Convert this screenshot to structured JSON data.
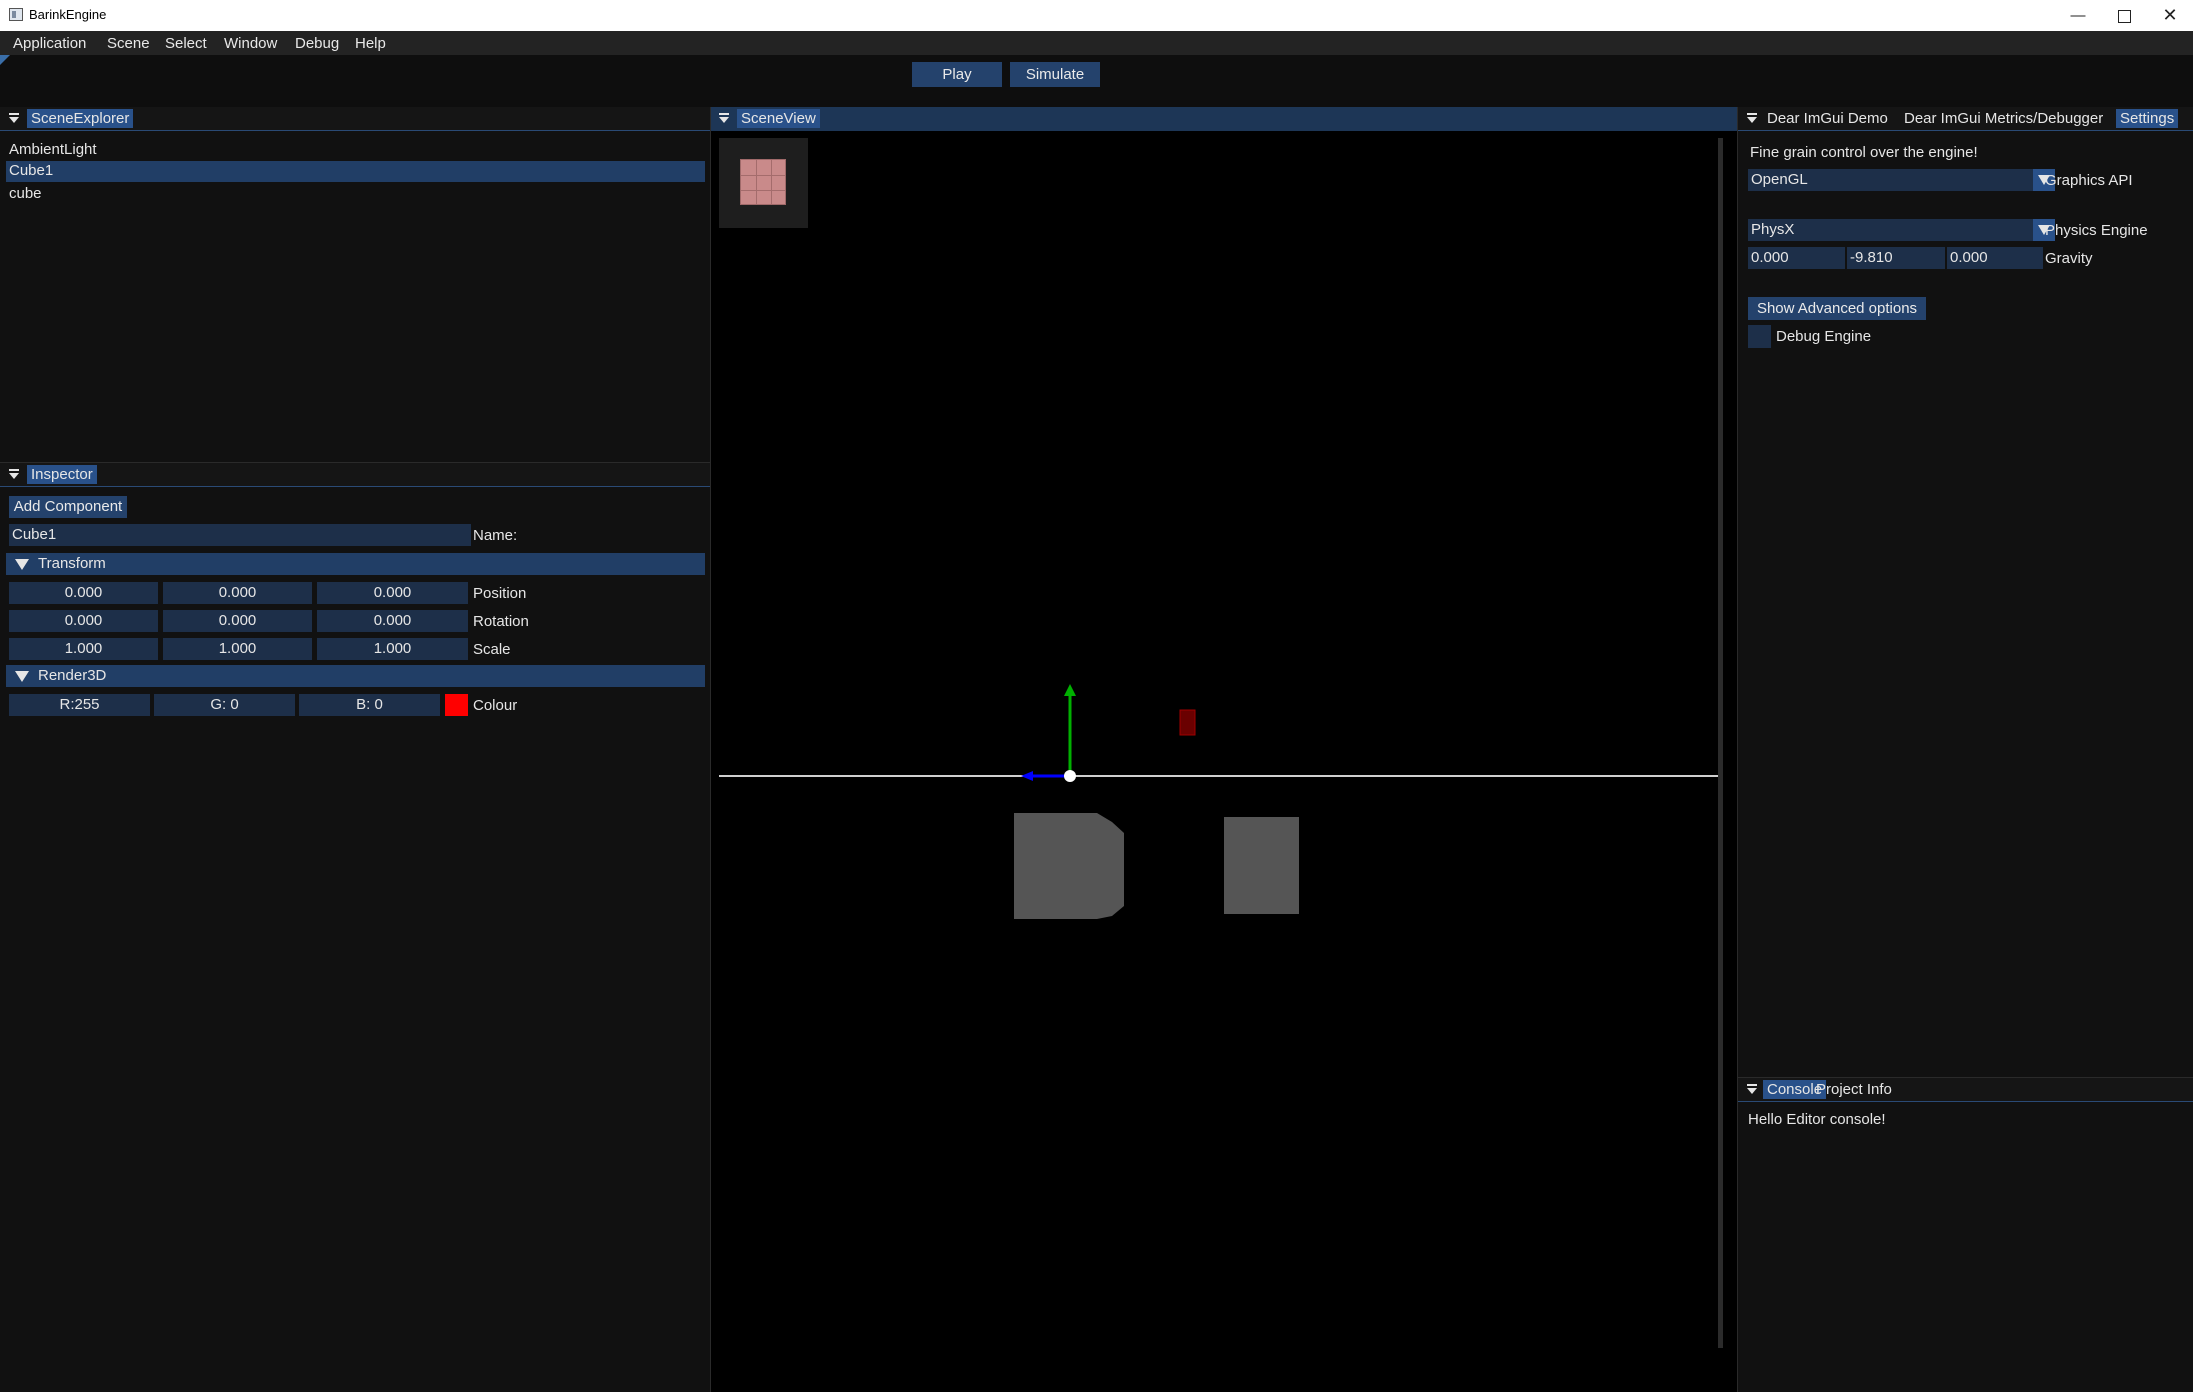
{
  "window": {
    "title": "BarinkEngine"
  },
  "menu": [
    "Application",
    "Scene",
    "Select",
    "Window",
    "Debug",
    "Help"
  ],
  "toolbar": {
    "play": "Play",
    "simulate": "Simulate"
  },
  "scene_explorer": {
    "tab": "SceneExplorer",
    "items": [
      "AmbientLight",
      "Cube1",
      "cube"
    ],
    "selected": "Cube1"
  },
  "inspector": {
    "tab": "Inspector",
    "add_component": "Add Component",
    "name_value": "Cube1",
    "name_label": "Name:",
    "transform": {
      "header": "Transform",
      "position": [
        "0.000",
        "0.000",
        "0.000"
      ],
      "position_label": "Position",
      "rotation": [
        "0.000",
        "0.000",
        "0.000"
      ],
      "rotation_label": "Rotation",
      "scale": [
        "1.000",
        "1.000",
        "1.000"
      ],
      "scale_label": "Scale"
    },
    "render3d": {
      "header": "Render3D",
      "r": "R:255",
      "g": "G:  0",
      "b": "B:  0",
      "colour_label": "Colour",
      "colour": "#ff0000"
    }
  },
  "scene_view": {
    "tab": "SceneView"
  },
  "settings_panel": {
    "tabs": [
      "Dear ImGui Demo",
      "Dear ImGui Metrics/Debugger",
      "Settings"
    ],
    "active_tab": "Settings",
    "intro": "Fine grain control over the engine!",
    "graphics_api": {
      "value": "OpenGL",
      "label": "Graphics API"
    },
    "physics_engine": {
      "value": "PhysX",
      "label": "Physics Engine"
    },
    "gravity": {
      "values": [
        "0.000",
        "-9.810",
        "0.000"
      ],
      "label": "Gravity"
    },
    "advanced_button": "Show Advanced options",
    "debug_engine_label": "Debug Engine",
    "debug_engine_checked": false
  },
  "console_panel": {
    "tabs": [
      "Console",
      "Project Info"
    ],
    "active_tab": "Console",
    "lines": [
      "Hello Editor console!"
    ]
  },
  "colors": {
    "accent": "#29518a",
    "field": "#1d2f49",
    "header": "#213e66",
    "gizmo_y": "#00b000",
    "gizmo_x": "#0000ff"
  }
}
